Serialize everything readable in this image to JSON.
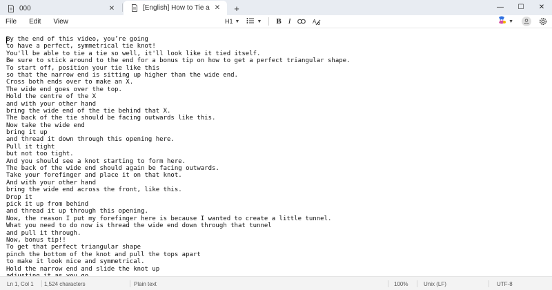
{
  "tabs": [
    {
      "label": "000",
      "active": false
    },
    {
      "label": "[English] How to Tie a Tie _ Easy W",
      "active": true
    }
  ],
  "new_tab_label": "+",
  "window_controls": {
    "minimize": "—",
    "maximize": "☐",
    "close": "✕"
  },
  "menu": {
    "file": "File",
    "edit": "Edit",
    "view": "View"
  },
  "toolbar": {
    "heading": "H1"
  },
  "editor": {
    "lines": [
      "By the end of this video, you’re going",
      "to have a perfect, symmetrical tie knot!",
      "You'll be able to tie a tie so well, it'll look like it tied itself.",
      "Be sure to stick around to the end for a bonus tip on how to get a perfect triangular shape.",
      "To start off, position your tie like this",
      "so that the narrow end is sitting up higher than the wide end.",
      "Cross both ends over to make an X.",
      "The wide end goes over the top.",
      "Hold the centre of the X",
      "and with your other hand",
      "bring the wide end of the tie behind that X.",
      "The back of the tie should be facing outwards like this.",
      "Now take the wide end",
      "bring it up",
      "and thread it down through this opening here.",
      "Pull it tight",
      "but not too tight.",
      "And you should see a knot starting to form here.",
      "The back of the wide end should again be facing outwards.",
      "Take your forefinger and place it on that knot.",
      "And with your other hand",
      "bring the wide end across the front, like this.",
      "Drop it",
      "pick it up from behind",
      "and thread it up through this opening.",
      "Now, the reason I put my forefinger here is because I wanted to create a little tunnel.",
      "What you need to do now is thread the wide end down through that tunnel",
      "and pull it through.",
      "Now, bonus tip!!",
      "To get that perfect triangular shape",
      "pinch the bottom of the knot and pull the tops apart",
      "to make it look nice and symmetrical.",
      "Hold the narrow end and slide the knot up",
      "adjusting it as you go"
    ]
  },
  "status": {
    "position": "Ln 1, Col 1",
    "characters": "1,524 characters",
    "format": "Plain text",
    "zoom": "100%",
    "line_ending": "Unix (LF)",
    "encoding": "UTF-8"
  },
  "colors": {
    "tabbar_bg": "#e8ecf2",
    "active_tab_bg": "#ffffff",
    "statusbar_bg": "#f3f3f3",
    "copilot_blue": "#2f6fe0",
    "copilot_pink": "#d64fa0",
    "copilot_yellow": "#f2b400"
  },
  "icons": {
    "tab": "document-icon",
    "list": "bullet-list-icon",
    "bold": "bold-icon",
    "italic": "italic-icon",
    "link": "link-icon",
    "clear_format": "clear-formatting-icon",
    "copilot": "copilot-icon",
    "account": "account-icon",
    "settings": "gear-icon"
  }
}
